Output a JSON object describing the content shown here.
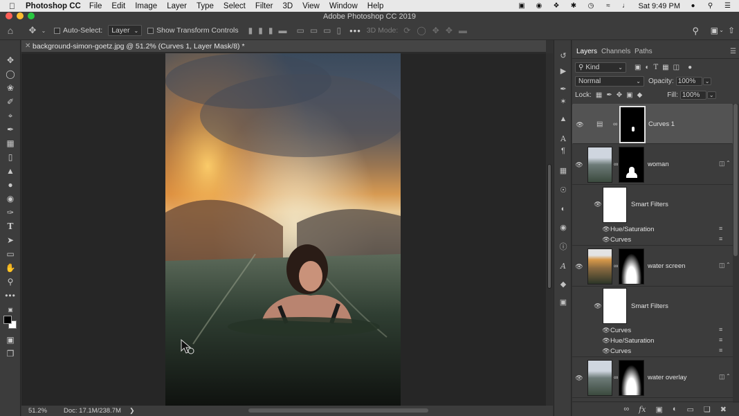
{
  "menubar": {
    "app_name": "Photoshop CC",
    "items": [
      "File",
      "Edit",
      "Image",
      "Layer",
      "Type",
      "Select",
      "Filter",
      "3D",
      "View",
      "Window",
      "Help"
    ],
    "clock": "Sat 9:49 PM"
  },
  "window": {
    "title": "Adobe Photoshop CC 2019"
  },
  "options": {
    "auto_select_label": "Auto-Select:",
    "auto_select_value": "Layer",
    "show_transform_label": "Show Transform Controls",
    "mode_3d_label": "3D Mode:"
  },
  "document": {
    "tab_title": "background-simon-goetz.jpg @ 51.2% (Curves 1, Layer Mask/8) *",
    "zoom": "51.2%",
    "doc_size": "Doc: 17.1M/238.7M"
  },
  "panel": {
    "tabs": [
      "Layers",
      "Channels",
      "Paths"
    ],
    "kind_label": "Kind",
    "blend_mode": "Normal",
    "opacity_label": "Opacity:",
    "opacity_value": "100%",
    "lock_label": "Lock:",
    "fill_label": "Fill:",
    "fill_value": "100%"
  },
  "layers": [
    {
      "name": "Curves 1"
    },
    {
      "name": "woman"
    },
    {
      "name": "Smart Filters"
    },
    {
      "name": "Hue/Saturation"
    },
    {
      "name": "Curves"
    },
    {
      "name": "water screen"
    },
    {
      "name": "Smart Filters"
    },
    {
      "name": "Curves"
    },
    {
      "name": "Hue/Saturation"
    },
    {
      "name": "Curves"
    },
    {
      "name": "water overlay"
    }
  ],
  "icons": {
    "apple": "apple-icon",
    "home": "home-icon",
    "move": "move-tool-icon",
    "eye": "eye-icon",
    "chain": "link-icon"
  },
  "colors": {
    "menubar_bg": "#e8e8e8",
    "chrome_bg": "#3c3c3c",
    "canvas_bg": "#262626",
    "selected_layer": "#535353",
    "close_dot": "#fe5f57",
    "minimize_dot": "#febc2e",
    "zoom_dot": "#28c840"
  }
}
